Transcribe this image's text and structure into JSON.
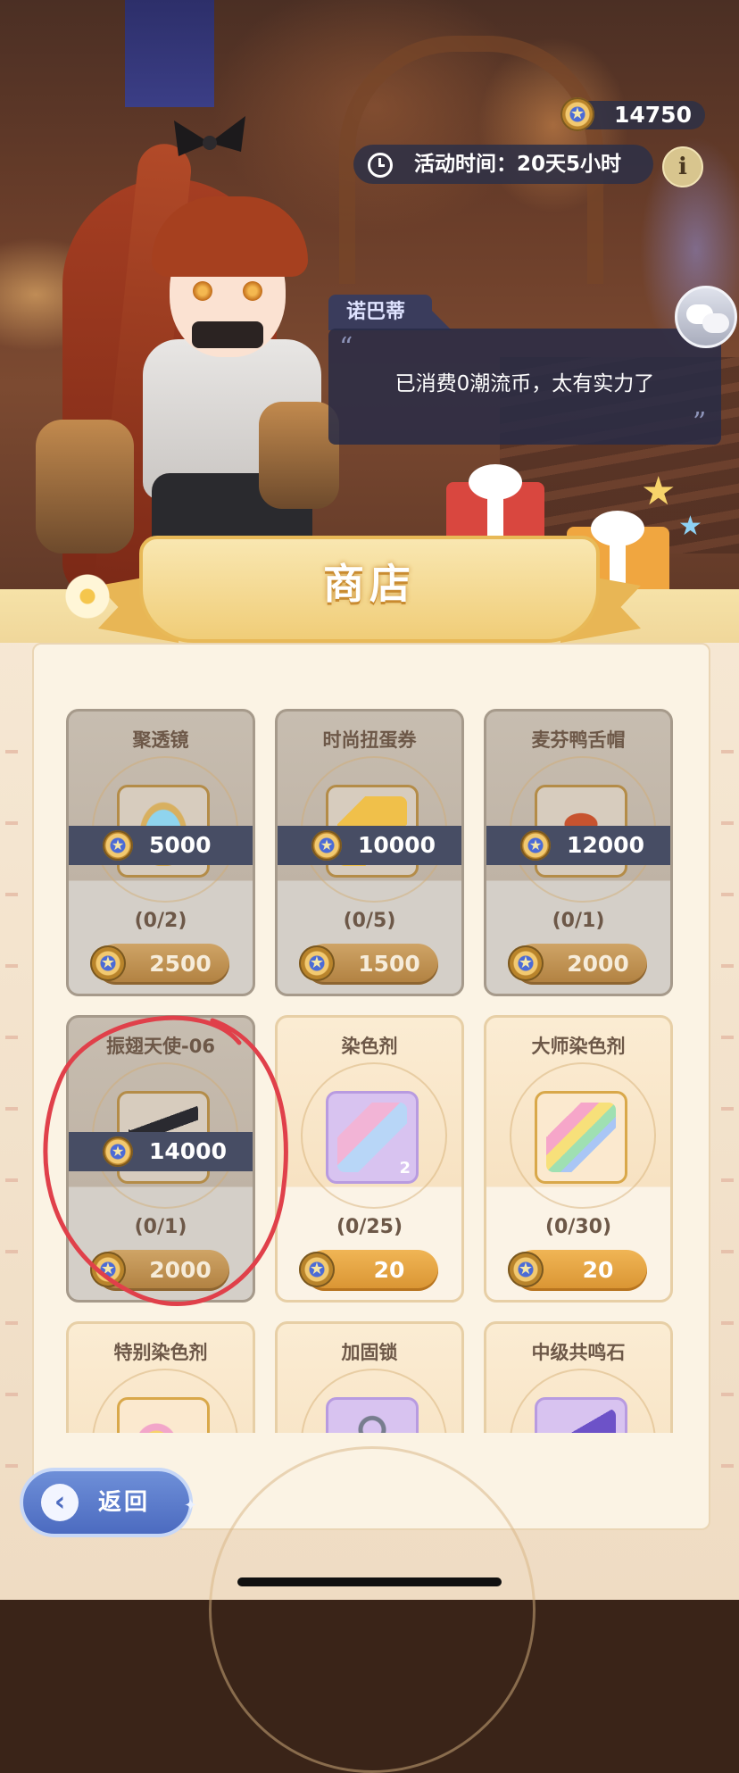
{
  "hud": {
    "currency_amount": "14750",
    "event_time_label": "活动时间：20天5小时",
    "info_label": "i"
  },
  "dialog": {
    "speaker": "诺巴蒂",
    "text": "已消费0潮流币，太有实力了"
  },
  "shop": {
    "title": "商店",
    "items": [
      {
        "name": "聚透镜",
        "price": "5000",
        "limit": "(0/2)",
        "cost": "2500",
        "sold_out": true
      },
      {
        "name": "时尚扭蛋券",
        "price": "10000",
        "limit": "(0/5)",
        "cost": "1500",
        "sold_out": true
      },
      {
        "name": "麦芬鸭舌帽",
        "price": "12000",
        "limit": "(0/1)",
        "cost": "2000",
        "sold_out": true
      },
      {
        "name": "振翅天使-06",
        "price": "14000",
        "limit": "(0/1)",
        "cost": "2000",
        "sold_out": true
      },
      {
        "name": "染色剂",
        "limit": "(0/25)",
        "cost": "20",
        "quantity": "2",
        "sold_out": false
      },
      {
        "name": "大师染色剂",
        "limit": "(0/30)",
        "cost": "20",
        "sold_out": false
      },
      {
        "name": "特别染色剂",
        "sold_out": false
      },
      {
        "name": "加固锁",
        "sold_out": false
      },
      {
        "name": "中级共鸣石",
        "sold_out": false
      }
    ]
  },
  "footer": {
    "back_label": "返回"
  },
  "colors": {
    "button_gold": "#d99432",
    "price_bar": "#474d64",
    "annotation_red": "#e0404a",
    "back_button_blue": "#4c6bc0"
  }
}
